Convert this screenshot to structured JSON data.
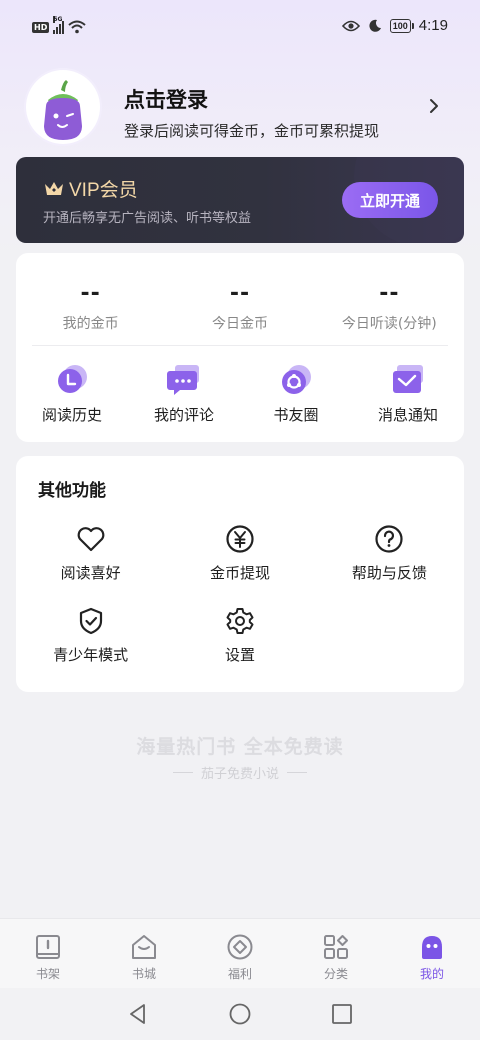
{
  "status_bar": {
    "network": "HD",
    "signal": "5G",
    "battery": "100",
    "time": "4:19"
  },
  "profile": {
    "title": "点击登录",
    "subtitle": "登录后阅读可得金币，金币可累积提现"
  },
  "vip": {
    "title": "VIP会员",
    "subtitle": "开通后畅享无广告阅读、听书等权益",
    "button": "立即开通"
  },
  "stats": [
    {
      "value": "--",
      "label": "我的金币"
    },
    {
      "value": "--",
      "label": "今日金币"
    },
    {
      "value": "--",
      "label": "今日听读(分钟)"
    }
  ],
  "quick_links": [
    {
      "label": "阅读历史",
      "icon": "history-icon"
    },
    {
      "label": "我的评论",
      "icon": "comment-icon"
    },
    {
      "label": "书友圈",
      "icon": "circle-icon"
    },
    {
      "label": "消息通知",
      "icon": "notification-icon"
    }
  ],
  "other": {
    "title": "其他功能",
    "items": [
      {
        "label": "阅读喜好",
        "icon": "heart-icon"
      },
      {
        "label": "金币提现",
        "icon": "yuan-icon"
      },
      {
        "label": "帮助与反馈",
        "icon": "help-icon"
      },
      {
        "label": "青少年模式",
        "icon": "shield-icon"
      },
      {
        "label": "设置",
        "icon": "gear-icon"
      }
    ]
  },
  "slogan": {
    "main": "海量热门书 全本免费读",
    "sub": "茄子免费小说"
  },
  "tabs": [
    {
      "label": "书架",
      "icon": "bookshelf-icon"
    },
    {
      "label": "书城",
      "icon": "bookstore-icon"
    },
    {
      "label": "福利",
      "icon": "coin-icon"
    },
    {
      "label": "分类",
      "icon": "category-icon"
    },
    {
      "label": "我的",
      "icon": "mine-icon",
      "active": true
    }
  ],
  "colors": {
    "accent": "#7b55e6",
    "vip_gold": "#f3d7a8",
    "vip_bg": "#2e2f3b"
  }
}
